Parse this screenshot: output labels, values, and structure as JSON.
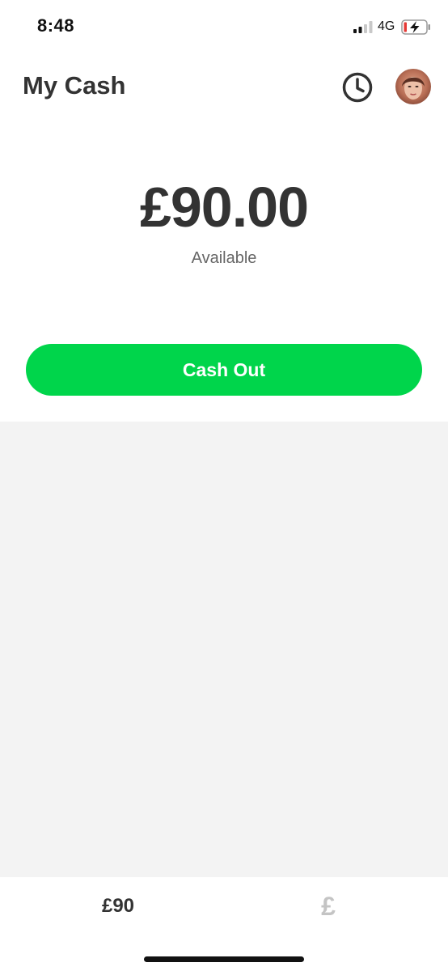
{
  "status_bar": {
    "time": "8:48",
    "network": "4G"
  },
  "header": {
    "title": "My Cash",
    "history_icon": "clock-icon",
    "avatar_icon": "profile-avatar"
  },
  "balance": {
    "amount": "£90.00",
    "caption": "Available"
  },
  "actions": {
    "cash_out_label": "Cash Out"
  },
  "tab_bar": {
    "balance_tab_label": "£90",
    "pay_tab_label": "£"
  },
  "colors": {
    "accent": "#00d54b",
    "text": "#333333",
    "content_background": "#f3f3f3",
    "inactive_tab": "#c4c4c4",
    "battery_low": "#e53935"
  }
}
